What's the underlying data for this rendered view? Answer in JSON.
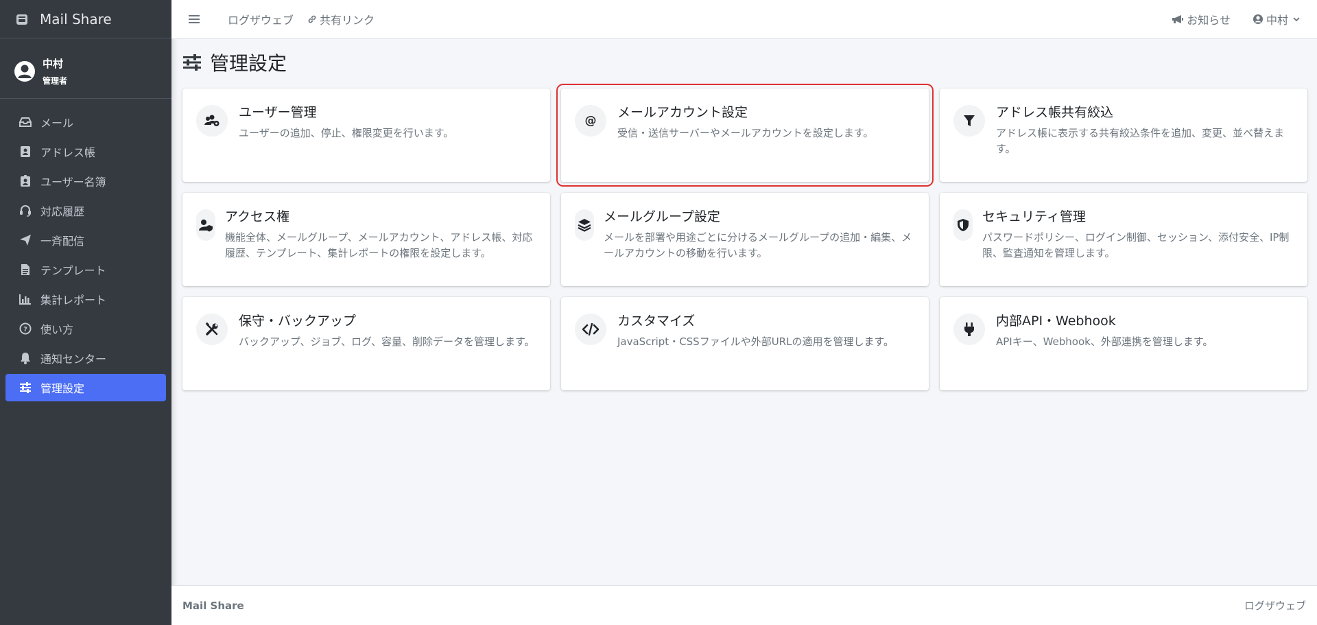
{
  "brand": {
    "name": "Mail Share",
    "icon": "mail-box-icon"
  },
  "user": {
    "name": "中村",
    "role": "管理者"
  },
  "sidebar": {
    "items": [
      {
        "label": "メール",
        "icon": "inbox-icon"
      },
      {
        "label": "アドレス帳",
        "icon": "address-book-icon"
      },
      {
        "label": "ユーザー名簿",
        "icon": "id-badge-icon"
      },
      {
        "label": "対応履歴",
        "icon": "headset-icon"
      },
      {
        "label": "一斉配信",
        "icon": "paper-plane-icon"
      },
      {
        "label": "テンプレート",
        "icon": "file-icon"
      },
      {
        "label": "集計レポート",
        "icon": "bar-chart-icon"
      },
      {
        "label": "使い方",
        "icon": "question-circle-icon"
      },
      {
        "label": "通知センター",
        "icon": "bell-icon"
      },
      {
        "label": "管理設定",
        "icon": "sliders-icon",
        "active": true
      }
    ]
  },
  "topbar": {
    "links": [
      {
        "label": "ログザウェブ"
      },
      {
        "label": "共有リンク",
        "icon": "link-icon"
      }
    ],
    "notice_label": "お知らせ",
    "user_label": "中村"
  },
  "page": {
    "title": "管理設定",
    "cards": [
      {
        "title": "ユーザー管理",
        "desc": "ユーザーの追加、停止、権限変更を行います。",
        "icon": "users-cog-icon"
      },
      {
        "title": "メールアカウント設定",
        "desc": "受信・送信サーバーやメールアカウントを設定します。",
        "icon": "at-sign-icon",
        "highlighted": true
      },
      {
        "title": "アドレス帳共有絞込",
        "desc": "アドレス帳に表示する共有絞込条件を追加、変更、並べ替えます。",
        "icon": "filter-icon"
      },
      {
        "title": "アクセス権",
        "desc": "機能全体、メールグループ、メールアカウント、アドレス帳、対応履歴、テンプレート、集計レポートの権限を設定します。",
        "icon": "user-shield-icon"
      },
      {
        "title": "メールグループ設定",
        "desc": "メールを部署や用途ごとに分けるメールグループの追加・編集、メールアカウントの移動を行います。",
        "icon": "layers-icon"
      },
      {
        "title": "セキュリティ管理",
        "desc": "パスワードポリシー、ログイン制御、セッション、添付安全、IP制限、監査通知を管理します。",
        "icon": "shield-icon"
      },
      {
        "title": "保守・バックアップ",
        "desc": "バックアップ、ジョブ、ログ、容量、削除データを管理します。",
        "icon": "tools-icon"
      },
      {
        "title": "カスタマイズ",
        "desc": "JavaScript・CSSファイルや外部URLの適用を管理します。",
        "icon": "code-icon"
      },
      {
        "title": "内部API・Webhook",
        "desc": "APIキー、Webhook、外部連携を管理します。",
        "icon": "plug-icon"
      }
    ]
  },
  "footer": {
    "left": "Mail Share",
    "right": "ログザウェブ"
  },
  "colors": {
    "sidebar_bg": "#343a40",
    "active_item": "#4c6ef5",
    "highlight": "#e03131"
  }
}
